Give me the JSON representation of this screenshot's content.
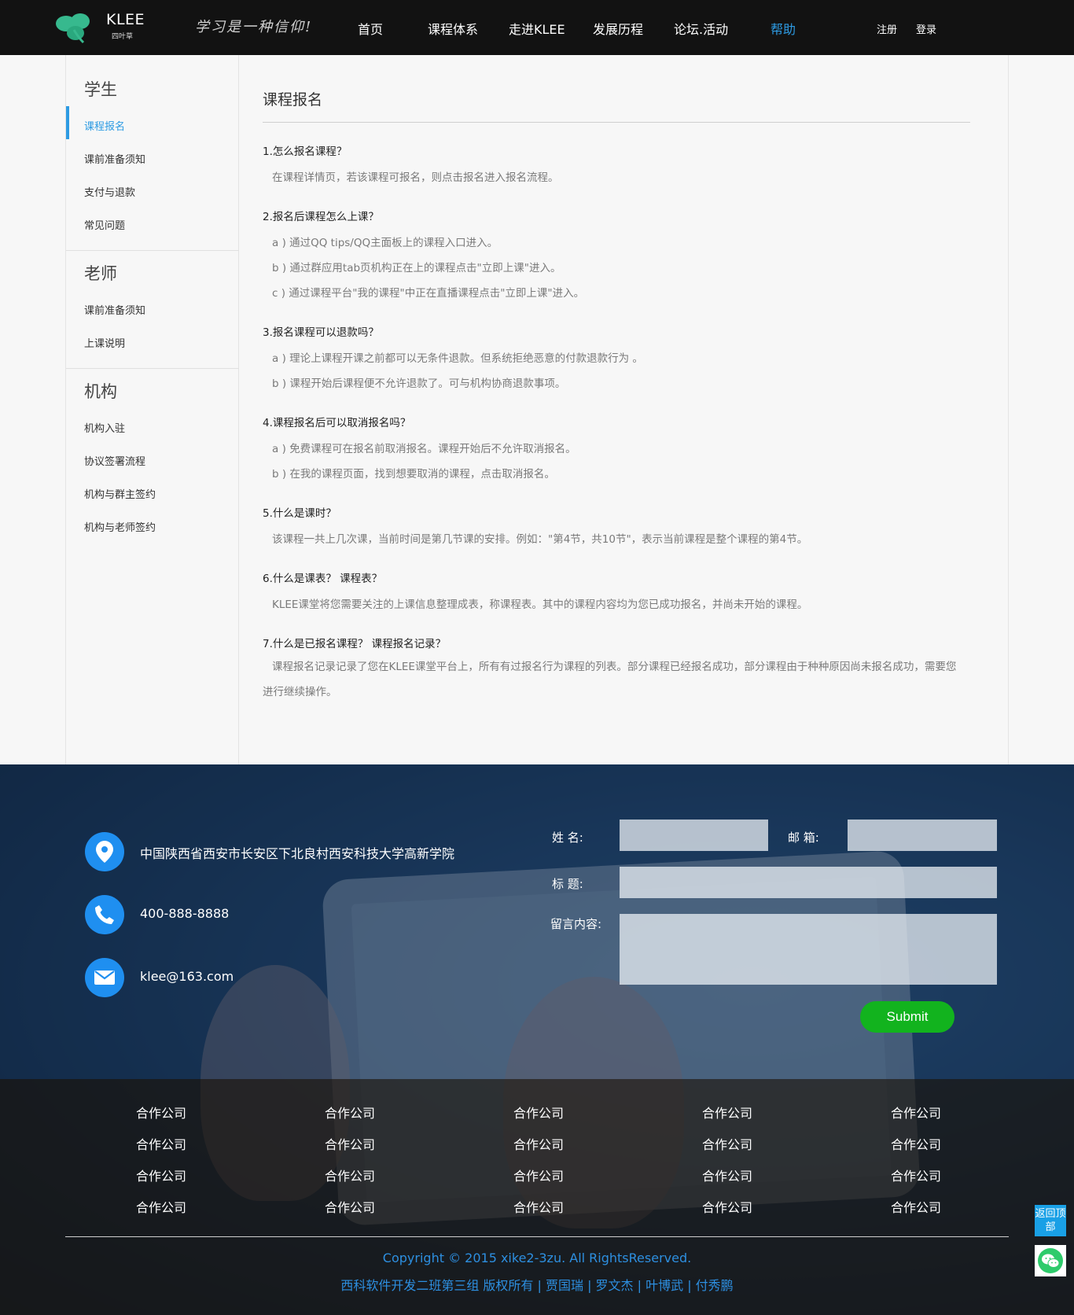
{
  "header": {
    "logo_text": "KLEE",
    "logo_sub": "四叶草",
    "slogan": "学习是一种信仰!",
    "nav": [
      {
        "label": "首页"
      },
      {
        "label": "课程体系"
      },
      {
        "label": "走进KLEE"
      },
      {
        "label": "发展历程"
      },
      {
        "label": "论坛.活动"
      },
      {
        "label": "帮助",
        "active": true
      }
    ],
    "register_label": "注册",
    "login_label": "登录",
    "active_color": "#2d9be3"
  },
  "sidebar": {
    "groups": [
      {
        "title": "学生",
        "items": [
          "课程报名",
          "课前准备须知",
          "支付与退款",
          "常见问题"
        ]
      },
      {
        "title": "老师",
        "items": [
          "课前准备须知",
          "上课说明"
        ]
      },
      {
        "title": "机构",
        "items": [
          "机构入驻",
          "协议签署流程",
          "机构与群主签约",
          "机构与老师签约"
        ]
      }
    ],
    "active_item": "课程报名"
  },
  "main": {
    "title": "课程报名",
    "qa": [
      {
        "q": "1.怎么报名课程？",
        "a": [
          "在课程详情页，若该课程可报名，则点击报名进入报名流程。"
        ]
      },
      {
        "q": "2.报名后课程怎么上课？",
        "a": [
          "a ) 通过QQ tips/QQ主面板上的课程入口进入。",
          "b ) 通过群应用tab页机构正在上的课程点击\"立即上课\"进入。",
          "c ) 通过课程平台\"我的课程\"中正在直播课程点击\"立即上课\"进入。"
        ]
      },
      {
        "q": "3.报名课程可以退款吗？",
        "a": [
          "a ) 理论上课程开课之前都可以无条件退款。但系统拒绝恶意的付款退款行为 。",
          "b ) 课程开始后课程便不允许退款了。可与机构协商退款事项。"
        ]
      },
      {
        "q": "4.课程报名后可以取消报名吗？",
        "a": [
          "a ) 免费课程可在报名前取消报名。课程开始后不允许取消报名。",
          "b ) 在我的课程页面，找到想要取消的课程，点击取消报名。"
        ]
      },
      {
        "q": "5.什么是课时？",
        "a": [
          "该课程一共上几次课，当前时间是第几节课的安排。例如：\"第4节，共10节\"，表示当前课程是整个课程的第4节。"
        ]
      },
      {
        "q": "6.什么是课表？ 课程表？",
        "a": [
          "KLEE课堂将您需要关注的上课信息整理成表，称课程表。其中的课程内容均为您已成功报名，并尚未开始的课程。"
        ]
      },
      {
        "q": "7.什么是已报名课程？ 课程报名记录？",
        "a": [
          "课程报名记录记录了您在KLEE课堂平台上，所有有过报名行为课程的列表。部分课程已经报名成功，部分课程由于种种原因尚未报名成功，需要您进行继续操作。"
        ]
      }
    ]
  },
  "footer": {
    "address": "中国陕西省西安市长安区下北良村西安科技大学高新学院",
    "phone": "400-888-8888",
    "email": "klee@163.com",
    "form": {
      "name_label": "姓    名:",
      "email_label": "邮    箱:",
      "subject_label": "标    题:",
      "message_label": "留言内容:",
      "submit_label": "Submit",
      "submit_color": "#12b31e"
    },
    "partners": [
      [
        "合作公司",
        "合作公司",
        "合作公司",
        "合作公司",
        "合作公司"
      ],
      [
        "合作公司",
        "合作公司",
        "合作公司",
        "合作公司",
        "合作公司"
      ],
      [
        "合作公司",
        "合作公司",
        "合作公司",
        "合作公司",
        "合作公司"
      ],
      [
        "合作公司",
        "合作公司",
        "合作公司",
        "合作公司",
        "合作公司"
      ]
    ],
    "copyright": "Copyright © 2015 xike2-3zu. All RightsReserved.",
    "credits": "西科软件开发二班第三组 版权所有 | 贾国瑞 | 罗文杰 | 叶博武 | 付秀鹏",
    "copyright_color": "#2d8fe0"
  },
  "floating": {
    "back_to_top": "返回顶部",
    "wechat_icon": "wechat-icon"
  }
}
